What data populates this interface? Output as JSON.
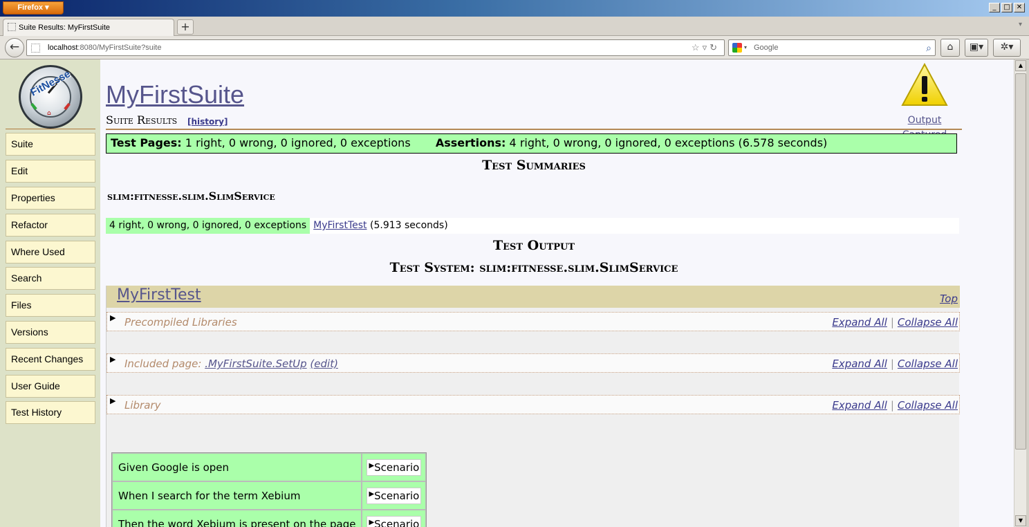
{
  "browser": {
    "app_button": "Firefox",
    "tab_title": "Suite Results: MyFirstSuite",
    "url_host": "localhost",
    "url_rest": ":8080/MyFirstSuite?suite",
    "search_placeholder": "Google"
  },
  "sidebar": {
    "logo_text": "FitNesse",
    "items": [
      {
        "label": "Suite"
      },
      {
        "label": "Edit"
      },
      {
        "label": "Properties"
      },
      {
        "label": "Refactor"
      },
      {
        "label": "Where Used"
      },
      {
        "label": "Search"
      },
      {
        "label": "Files"
      },
      {
        "label": "Versions"
      },
      {
        "label": "Recent Changes"
      },
      {
        "label": "User Guide"
      },
      {
        "label": "Test History"
      }
    ]
  },
  "header": {
    "title": "MyFirstSuite",
    "page_type": "Suite Results",
    "history_link": "[history]",
    "output_captured": "Output Captured"
  },
  "summary": {
    "pages_label": "Test Pages:",
    "pages_counts": "1 right, 0 wrong, 0 ignored, 0 exceptions",
    "assertions_label": "Assertions:",
    "assertions_counts": "4 right, 0 wrong, 0 ignored, 0 exceptions (6.578 seconds)"
  },
  "test_summaries": {
    "heading": "Test Summaries",
    "test_system": "slim:fitnesse.slim.SlimService",
    "row": {
      "counts": "4 right, 0 wrong, 0 ignored, 0 exceptions",
      "test_link": "MyFirstTest",
      "duration": "(5.913 seconds)"
    }
  },
  "test_output": {
    "heading": "Test Output",
    "system_heading": "Test System: slim:fitnesse.slim.SlimService",
    "test_name": "MyFirstTest",
    "top_link": "Top",
    "sections": [
      {
        "title": "Precompiled Libraries",
        "prefix": "",
        "page_link": "",
        "edit_link": ""
      },
      {
        "title": "",
        "prefix": "Included page: ",
        "page_link": ".MyFirstSuite.SetUp",
        "edit_link": "(edit)"
      },
      {
        "title": "Library",
        "prefix": "",
        "page_link": "",
        "edit_link": ""
      }
    ],
    "expand_all": "Expand All",
    "collapse_all": "Collapse All",
    "separator": "|",
    "scenario_rows": [
      {
        "step": "Given Google is open",
        "action": "Scenario"
      },
      {
        "step": "When I search for the term Xebium",
        "action": "Scenario"
      },
      {
        "step": "Then the word Xebium is present on the page",
        "action": "Scenario"
      }
    ]
  },
  "colors": {
    "pass_green": "#aaffaa",
    "sidebar_bg": "#dde2c8",
    "button_bg": "#fcf7d0",
    "link": "#56558c",
    "test_header_bg": "#ddd5a8"
  }
}
